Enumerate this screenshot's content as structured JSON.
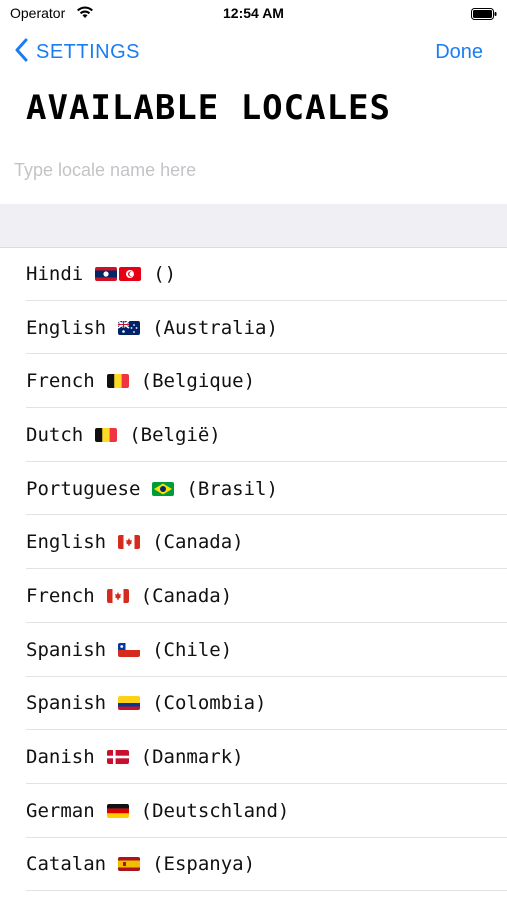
{
  "status": {
    "carrier": "Operator",
    "time": "12:54 AM"
  },
  "nav": {
    "back_label": "SETTINGS",
    "done_label": "Done"
  },
  "page": {
    "title": "AVAILABLE LOCALES"
  },
  "search": {
    "placeholder": "Type locale name here",
    "value": ""
  },
  "colors": {
    "accent": "#1a7ef2",
    "section_bg": "#efeff4"
  },
  "locales": [
    {
      "language": "Hindi",
      "region": "()",
      "flag": "laos-tunisia-flags"
    },
    {
      "language": "English",
      "region": "(Australia)",
      "flag": "australia-flag"
    },
    {
      "language": "French",
      "region": "(Belgique)",
      "flag": "belgium-flag"
    },
    {
      "language": "Dutch",
      "region": "(België)",
      "flag": "belgium-flag"
    },
    {
      "language": "Portuguese",
      "region": "(Brasil)",
      "flag": "brazil-flag"
    },
    {
      "language": "English",
      "region": "(Canada)",
      "flag": "canada-flag"
    },
    {
      "language": "French",
      "region": "(Canada)",
      "flag": "canada-flag"
    },
    {
      "language": "Spanish",
      "region": "(Chile)",
      "flag": "chile-flag"
    },
    {
      "language": "Spanish",
      "region": "(Colombia)",
      "flag": "colombia-flag"
    },
    {
      "language": "Danish",
      "region": "(Danmark)",
      "flag": "denmark-flag"
    },
    {
      "language": "German",
      "region": "(Deutschland)",
      "flag": "germany-flag"
    },
    {
      "language": "Catalan",
      "region": "(Espanya)",
      "flag": "spain-flag"
    }
  ]
}
